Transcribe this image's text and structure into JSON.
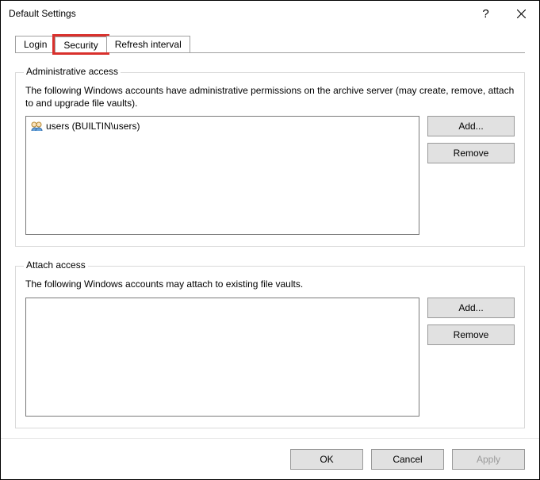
{
  "window": {
    "title": "Default Settings"
  },
  "tabs": {
    "login": "Login",
    "security": "Security",
    "refresh": "Refresh interval"
  },
  "admin": {
    "title": "Administrative access",
    "desc": "The following Windows accounts have administrative permissions on the archive server (may create, remove, attach to and upgrade file vaults).",
    "items": {
      "0": {
        "label": "users (BUILTIN\\users)"
      }
    },
    "add": "Add...",
    "remove": "Remove"
  },
  "attach": {
    "title": "Attach access",
    "desc": "The following Windows accounts may attach to existing file vaults.",
    "add": "Add...",
    "remove": "Remove"
  },
  "footer": {
    "ok": "OK",
    "cancel": "Cancel",
    "apply": "Apply"
  }
}
